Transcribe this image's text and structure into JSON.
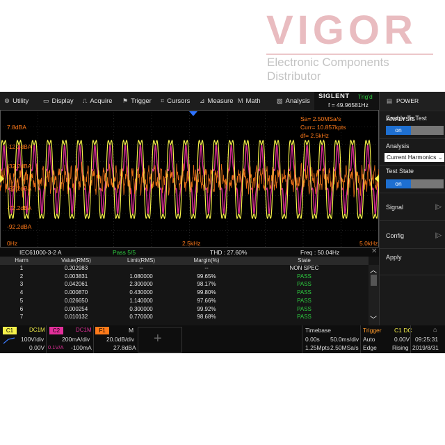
{
  "watermark": {
    "logo": "VIGOR",
    "tagline": "Electronic Components Distributor"
  },
  "menu": {
    "items": [
      {
        "label": "Utility",
        "icon": "gear-icon",
        "glyph": "⚙"
      },
      {
        "label": "Display",
        "icon": "monitor-icon",
        "glyph": "▭"
      },
      {
        "label": "Acquire",
        "icon": "acquire-icon",
        "glyph": "⎍"
      },
      {
        "label": "Trigger",
        "icon": "trigger-icon",
        "glyph": "⚑"
      },
      {
        "label": "Cursors",
        "icon": "cursor-icon",
        "glyph": "⌗"
      },
      {
        "label": "Measure",
        "icon": "measure-icon",
        "glyph": "⊿"
      },
      {
        "label": "Math",
        "icon": "math-icon",
        "glyph": "M"
      },
      {
        "label": "Analysis",
        "icon": "analysis-icon",
        "glyph": "▧"
      }
    ]
  },
  "header": {
    "brand": "SIGLENT",
    "trig_status": "Trig'd",
    "frequency": "f = 49.96581Hz"
  },
  "side_panel": {
    "title": "POWER ANALYSIS",
    "enable_label": "Enable To Test",
    "enable_value": "on",
    "analysis_label": "Analysis",
    "analysis_value": "Current Harmonics",
    "test_state_label": "Test State",
    "test_state_value": "on",
    "signal_label": "Signal",
    "config_label": "Config",
    "apply_label": "Apply"
  },
  "plot": {
    "sa_text": "Sa= 2.50MSa/s",
    "curr_text": "Curr= 10.857kpts",
    "df_text": "df= 2.5kHz",
    "left_labels": [
      "7.8dBA",
      "-12.2dBA",
      "-32.2dBA",
      "-52.2dBA",
      "-72.2dBA",
      "-92.2dBA"
    ],
    "x_start": "0Hz",
    "x_mid": "2.5kHz",
    "x_end": "5.0kHz",
    "colors": {
      "ch1": "#f5f04a",
      "ch2": "#e22f9a",
      "fft": "#ff7a1a"
    }
  },
  "results": {
    "standard": "IEC61000-3-2 A",
    "pass_summary": "Pass 5/5",
    "thd": "THD : 27.60%",
    "freq": "Freq : 50.04Hz",
    "columns": [
      "Harm",
      "Value(RMS)",
      "Limit(RMS)",
      "Margin(%)",
      "State"
    ],
    "rows": [
      {
        "harm": "1",
        "value": "0.202983",
        "limit": "--",
        "margin": "--",
        "state": "NON SPEC"
      },
      {
        "harm": "2",
        "value": "0.003831",
        "limit": "1.080000",
        "margin": "99.65%",
        "state": "PASS"
      },
      {
        "harm": "3",
        "value": "0.042061",
        "limit": "2.300000",
        "margin": "98.17%",
        "state": "PASS"
      },
      {
        "harm": "4",
        "value": "0.000870",
        "limit": "0.430000",
        "margin": "99.80%",
        "state": "PASS"
      },
      {
        "harm": "5",
        "value": "0.026650",
        "limit": "1.140000",
        "margin": "97.66%",
        "state": "PASS"
      },
      {
        "harm": "6",
        "value": "0.000254",
        "limit": "0.300000",
        "margin": "99.92%",
        "state": "PASS"
      },
      {
        "harm": "7",
        "value": "0.010132",
        "limit": "0.770000",
        "margin": "98.68%",
        "state": "PASS"
      }
    ]
  },
  "status": {
    "c1_label": "C1",
    "c1_coupling": "DC1M",
    "c1_scale": "100V/div",
    "c1_offset": "0.00V",
    "c2_label": "C2",
    "c2_coupling": "DC1M",
    "c2_scale": "200mA/div",
    "c2_probe": "0.1V/A",
    "c2_offset": "-100mA",
    "f1_label": "F1",
    "f1_mode": "M",
    "f1_scale": "20.0dB/div",
    "f1_offset": "27.8dBA",
    "timebase_label": "Timebase",
    "timebase_delay": "0.00s",
    "timebase_scale": "50.0ms/div",
    "timebase_pts": "1.25Mpts",
    "timebase_rate": "2.50MSa/s",
    "trigger_label": "Trigger",
    "trigger_src": "C1 DC",
    "trigger_mode": "Auto",
    "trigger_level": "0.00V",
    "trigger_type": "Edge",
    "trigger_slope": "Rising",
    "time": "09:25:31",
    "date": "2019/8/31"
  }
}
